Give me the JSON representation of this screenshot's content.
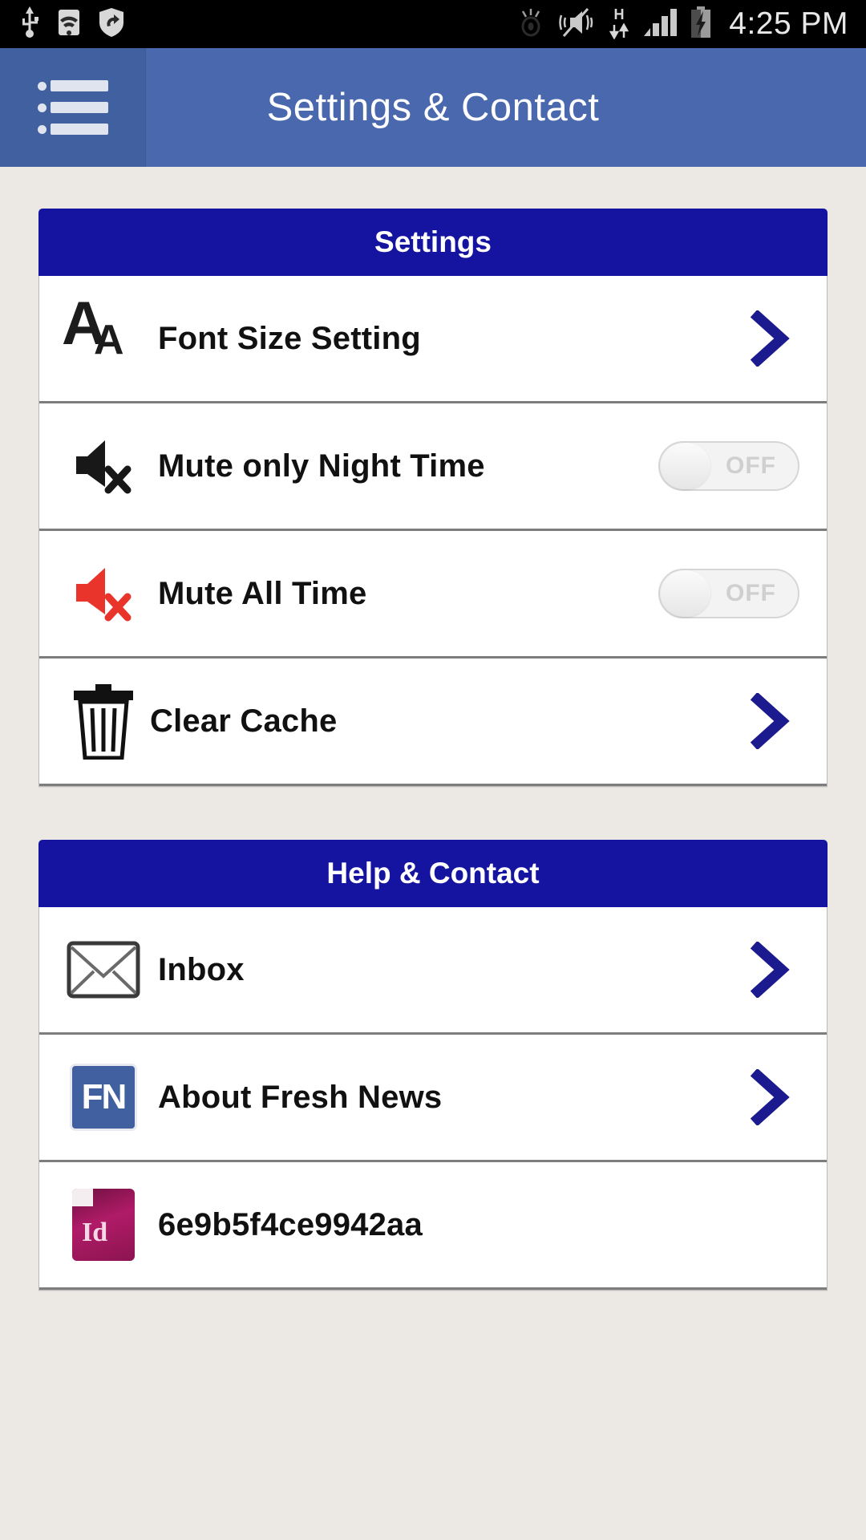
{
  "statusbar": {
    "time": "4:25 PM",
    "icons": [
      "usb-icon",
      "wifi-icon",
      "shield-sync-icon",
      "eye-icon",
      "mute-vibrate-icon",
      "hspa-data-icon",
      "signal-bars-icon",
      "battery-charging-icon"
    ]
  },
  "actionbar": {
    "menu_icon": "hamburger-menu-icon",
    "title": "Settings & Contact"
  },
  "sections": [
    {
      "title": "Settings",
      "rows": [
        {
          "icon": "font-size-aa-icon",
          "label": "Font Size Setting",
          "accessory": "chevron-right-icon"
        },
        {
          "icon": "mute-speaker-icon",
          "label": "Mute only Night Time",
          "accessory": "toggle",
          "toggle_state": "OFF"
        },
        {
          "icon": "mute-speaker-red-icon",
          "label": "Mute All Time",
          "accessory": "toggle",
          "toggle_state": "OFF"
        },
        {
          "icon": "trash-can-icon",
          "label": "Clear Cache",
          "accessory": "chevron-right-icon"
        }
      ]
    },
    {
      "title": "Help & Contact",
      "rows": [
        {
          "icon": "envelope-icon",
          "label": "Inbox",
          "accessory": "chevron-right-icon"
        },
        {
          "icon": "fresh-news-logo-icon",
          "label": "About Fresh News",
          "accessory": "chevron-right-icon"
        },
        {
          "icon": "indesign-id-icon",
          "label": "6e9b5f4ce9942aa",
          "accessory": "none"
        }
      ]
    }
  ],
  "colors": {
    "status_bar": "#000000",
    "action_bar": "#4a68ad",
    "menu_panel": "#41609f",
    "section_header": "#1414a0",
    "page_background": "#ece9e4",
    "chevron": "#1b1b8f",
    "mute_red": "#e8342a",
    "row_background": "#ffffff"
  }
}
